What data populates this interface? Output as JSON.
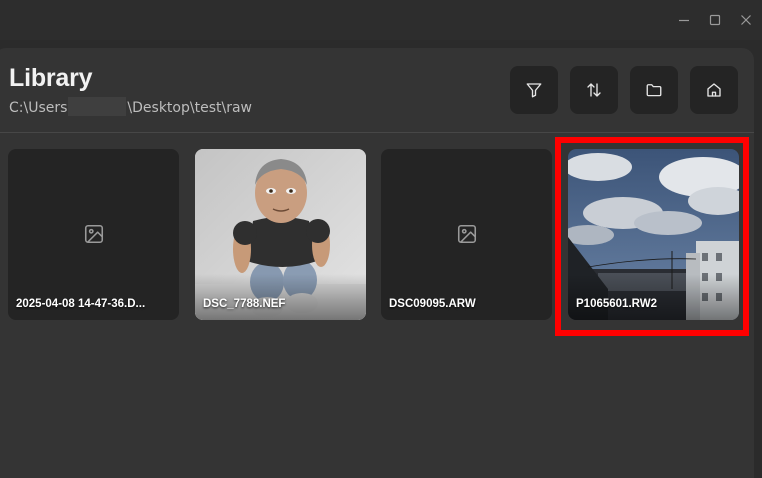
{
  "window": {
    "controls": [
      "minimize-icon",
      "maximize-icon",
      "close-icon"
    ]
  },
  "header": {
    "title": "Library",
    "path_prefix": "C:\\Users",
    "path_suffix": "\\Desktop\\test\\raw"
  },
  "toolbar": [
    {
      "name": "filter-button",
      "icon": "filter-icon"
    },
    {
      "name": "sort-button",
      "icon": "sort-arrows-icon"
    },
    {
      "name": "open-folder-button",
      "icon": "folder-icon"
    },
    {
      "name": "home-button",
      "icon": "home-icon"
    }
  ],
  "files": [
    {
      "name": "2025-04-08 14-47-36.D...",
      "thumbnail": "placeholder-image-icon"
    },
    {
      "name": "DSC_7788.NEF",
      "thumbnail": "plush-doll-photo"
    },
    {
      "name": "DSC09095.ARW",
      "thumbnail": "placeholder-image-icon"
    },
    {
      "name": "P1065601.RW2",
      "thumbnail": "sky-buildings-photo"
    }
  ],
  "colors": {
    "background": "#2b2b2b",
    "panel": "#343434",
    "card": "#242424",
    "highlight": "#ff0000"
  }
}
